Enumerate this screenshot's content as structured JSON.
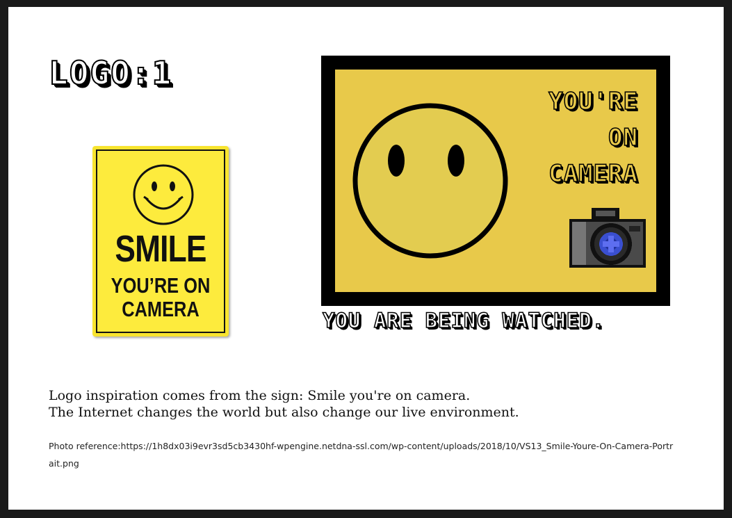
{
  "title": "LOGO:1",
  "sign": {
    "line1": "SMILE",
    "line2": "YOU’RE ON",
    "line3": "CAMERA"
  },
  "logo": {
    "word1": "YOU'RE",
    "word2": "ON",
    "word3": "CAMERA",
    "tagline": "YOU ARE BEING WATCHED."
  },
  "description": {
    "line1": "Logo inspiration comes from the sign: Smile you're on camera.",
    "line2": "The Internet changes the world but also change our live environment."
  },
  "reference": "Photo reference:https://1h8dx03i9evr3sd5cb3430hf-wpengine.netdna-ssl.com/wp-content/uploads/2018/10/VS13_Smile-Youre-On-Camera-Portrait.png",
  "colors": {
    "sign_yellow": "#fdeb3d",
    "logo_yellow": "#e8c94a",
    "frame": "#000000",
    "lens_blue": "#3a4fd0"
  }
}
